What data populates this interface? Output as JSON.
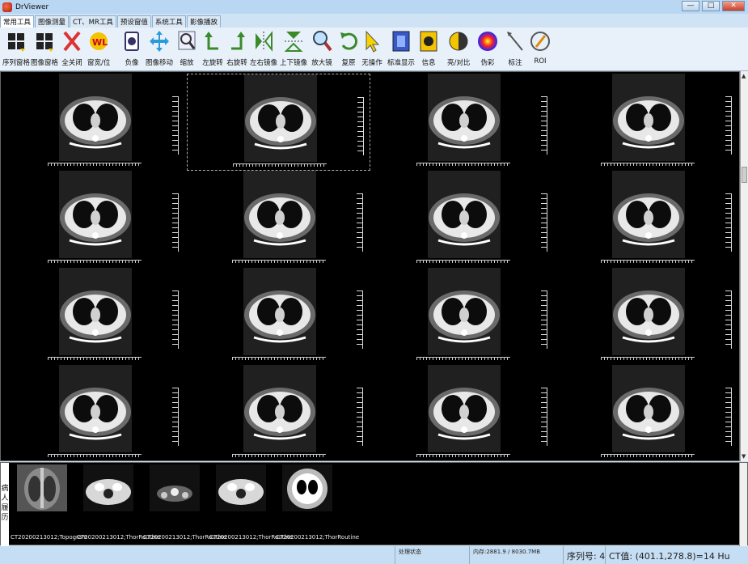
{
  "window": {
    "title": "DrViewer",
    "min_label": "—",
    "max_label": "□",
    "close_label": "✕"
  },
  "tabs": [
    "常用工具",
    "图像测量",
    "CT、MR工具",
    "预设窗值",
    "系统工具",
    "影像播放"
  ],
  "toolbar": [
    {
      "label": "序列窗格",
      "icon": "series-grid-icon"
    },
    {
      "label": "图像窗格",
      "icon": "image-grid-icon"
    },
    {
      "label": "全关闭",
      "icon": "close-all-icon"
    },
    {
      "label": "窗宽/位",
      "icon": "window-level-icon"
    },
    {
      "label": "负像",
      "icon": "negative-icon"
    },
    {
      "label": "图像移动",
      "icon": "pan-icon"
    },
    {
      "label": "缩放",
      "icon": "zoom-icon"
    },
    {
      "label": "左旋转",
      "icon": "rotate-left-icon"
    },
    {
      "label": "右旋转",
      "icon": "rotate-right-icon"
    },
    {
      "label": "左右镜像",
      "icon": "flip-horizontal-icon"
    },
    {
      "label": "上下镜像",
      "icon": "flip-vertical-icon"
    },
    {
      "label": "放大镜",
      "icon": "magnifier-icon"
    },
    {
      "label": "复原",
      "icon": "reset-icon"
    },
    {
      "label": "无操作",
      "icon": "pointer-icon"
    },
    {
      "label": "标准显示",
      "icon": "standard-display-icon"
    },
    {
      "label": "信息",
      "icon": "info-icon"
    },
    {
      "label": "亮/对比",
      "icon": "brightness-contrast-icon"
    },
    {
      "label": "伪彩",
      "icon": "pseudo-color-icon"
    },
    {
      "label": "标注",
      "icon": "annotate-icon"
    },
    {
      "label": "ROI",
      "icon": "roi-icon"
    }
  ],
  "side_label": "病人履历",
  "thumbnails": [
    {
      "caption": "CT20200213012;Topogram"
    },
    {
      "caption": "CT20200213012;ThorRoutine"
    },
    {
      "caption": "CT20200213012;ThorRoutine"
    },
    {
      "caption": "CT20200213012;ThorRoutine"
    },
    {
      "caption": "CT20200213012;ThorRoutine"
    }
  ],
  "status": {
    "processing": "处理状态",
    "memory": "内存:2881.9 / 8030.7MB",
    "series": "序列号: 4",
    "ct_value": "CT值: (401.1,278.8)=14 Hu"
  }
}
